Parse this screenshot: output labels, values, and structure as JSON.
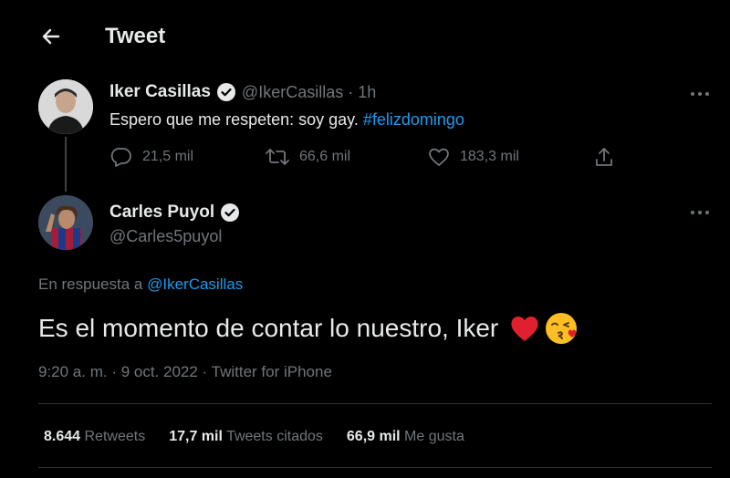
{
  "header": {
    "title": "Tweet"
  },
  "original_tweet": {
    "author_name": "Iker Casillas",
    "handle_time": "@IkerCasillas · 1h",
    "text": "Espero que me respeten: soy gay.",
    "hashtag": "#felizdomingo",
    "replies": "21,5 mil",
    "retweets": "66,6 mil",
    "likes": "183,3 mil"
  },
  "reply_tweet": {
    "author_name": "Carles Puyol",
    "handle": "@Carles5puyol",
    "reply_prefix": "En respuesta a",
    "reply_mention": "@IkerCasillas",
    "text": "Es el momento de contar lo nuestro, Iker",
    "meta": "9:20 a. m. · 9 oct. 2022 · Twitter for iPhone"
  },
  "stats": {
    "retweets_count": "8.644",
    "retweets_label": "Retweets",
    "quotes_count": "17,7 mil",
    "quotes_label": "Tweets citados",
    "likes_count": "66,9 mil",
    "likes_label": "Me gusta"
  },
  "colors": {
    "accent": "#1d9bf0",
    "background": "#000000",
    "muted": "#71767b"
  }
}
